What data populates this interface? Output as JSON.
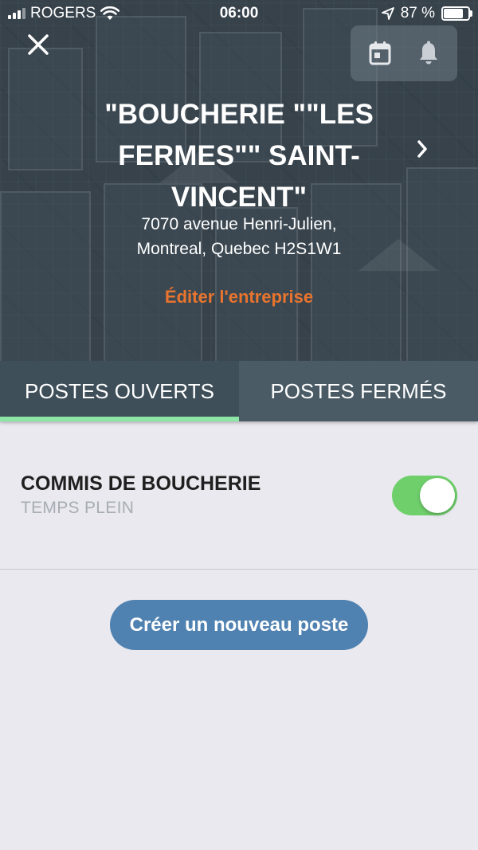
{
  "status_bar": {
    "carrier": "ROGERS",
    "time": "06:00",
    "battery_text": "87 %",
    "battery_level": 0.87
  },
  "header": {
    "company_name": "\"BOUCHERIE \"\"LES FERMES\"\" SAINT-VINCENT\"",
    "address_line1": "7070 avenue Henri-Julien,",
    "address_line2": "Montreal, Quebec H2S1W1",
    "edit_label": "Éditer l'entreprise",
    "icons": [
      "close-icon",
      "calendar-icon",
      "bell-icon",
      "chevron-right-icon"
    ]
  },
  "tabs": [
    {
      "label": "POSTES OUVERTS",
      "active": true
    },
    {
      "label": "POSTES FERMÉS",
      "active": false
    }
  ],
  "jobs": [
    {
      "title": "COMMIS DE BOUCHERIE",
      "type": "TEMPS PLEIN",
      "enabled": true
    }
  ],
  "create_button_label": "Créer un nouveau poste",
  "colors": {
    "accent_orange": "#e8742e",
    "tab_indicator": "#8ee6a6",
    "toggle_on": "#6fcf6b",
    "primary_button": "#4f81b1"
  }
}
